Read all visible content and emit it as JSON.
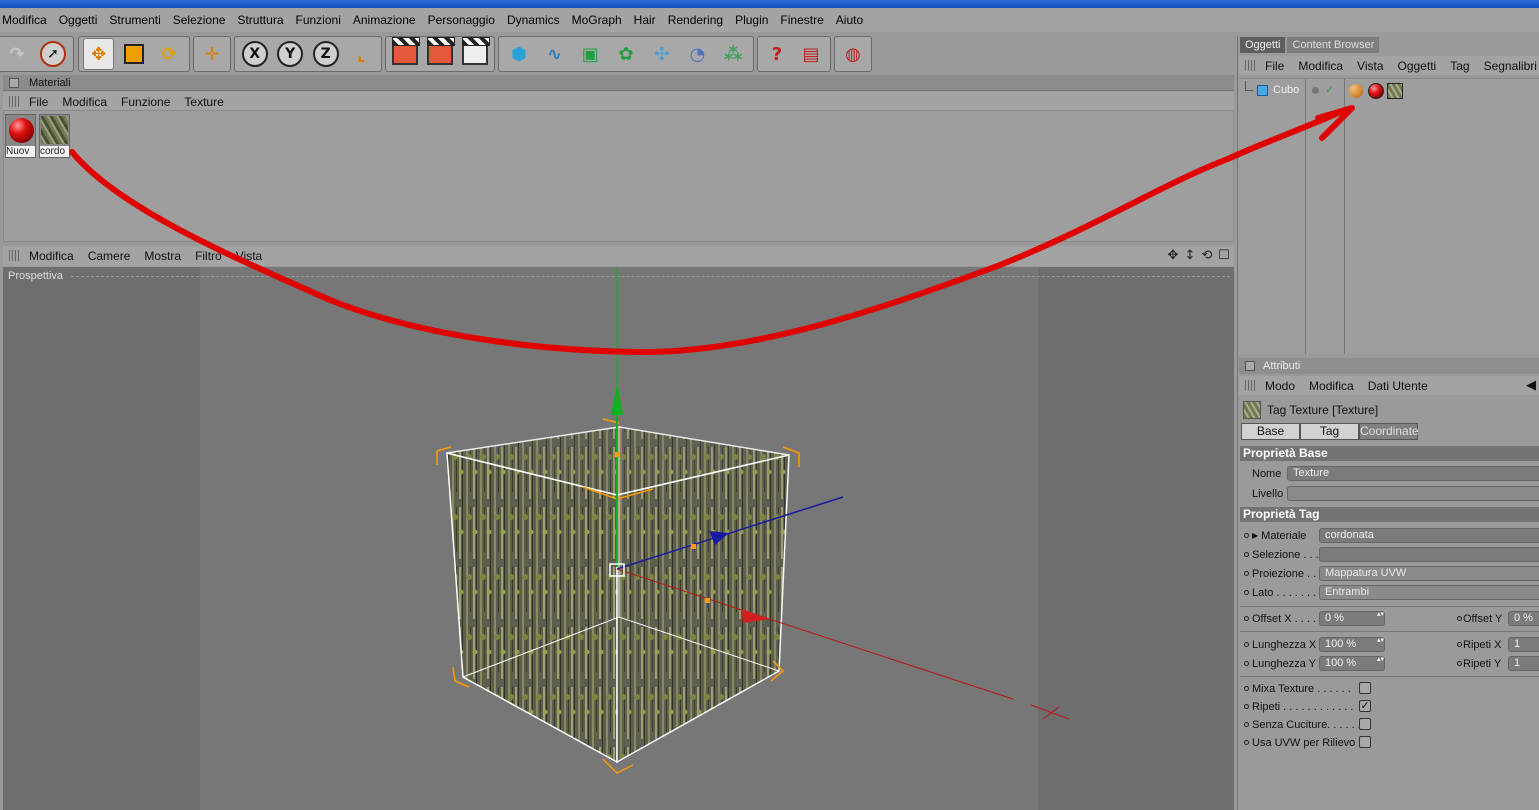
{
  "menubar": [
    "Modifica",
    "Oggetti",
    "Strumenti",
    "Selezione",
    "Struttura",
    "Funzioni",
    "Animazione",
    "Personaggio",
    "Dynamics",
    "MoGraph",
    "Hair",
    "Rendering",
    "Plugin",
    "Finestre",
    "Aiuto"
  ],
  "materials": {
    "title": "Materiali",
    "menu": [
      "File",
      "Modifica",
      "Funzione",
      "Texture"
    ],
    "items": [
      {
        "label": "Nuov"
      },
      {
        "label": "cordo"
      }
    ]
  },
  "viewport": {
    "menu": [
      "Modifica",
      "Camere",
      "Mostra",
      "Filtro",
      "Vista"
    ],
    "label": "Prospettiva"
  },
  "objects": {
    "tabs": [
      "Oggetti",
      "Content Browser"
    ],
    "menu": [
      "File",
      "Modifica",
      "Vista",
      "Oggetti",
      "Tag",
      "Segnalibri"
    ],
    "object_name": "Cubo"
  },
  "attributes": {
    "title": "Attributi",
    "menu": [
      "Modo",
      "Modifica",
      "Dati Utente"
    ],
    "tag_title": "Tag Texture [Texture]",
    "subtabs": [
      "Base",
      "Tag",
      "Coordinate"
    ],
    "section_base": "Proprietà Base",
    "nome_label": "Nome",
    "nome_value": "Texture",
    "livello_label": "Livello",
    "section_tag": "Proprietà Tag",
    "materiale_label": "Materiale",
    "materiale_value": "cordonata",
    "selezione_label": "Selezione . . .",
    "proiezione_label": "Proiezione . .",
    "proiezione_value": "Mappatura UVW",
    "lato_label": "Lato . . . . . . .",
    "lato_value": "Entrambi",
    "offsetx_label": "Offset X . . . .",
    "offsetx_value": "0 %",
    "offsety_label": "Offset Y",
    "offsety_value": "0 %",
    "lungx_label": "Lunghezza X",
    "lungx_value": "100 %",
    "ripetix_label": "Ripeti X",
    "ripetix_value": "1",
    "lungy_label": "Lunghezza Y",
    "lungy_value": "100 %",
    "ripetiy_label": "Ripeti Y",
    "ripetiy_value": "1",
    "mixa_label": "Mixa Texture . . . . . .",
    "mixa_checked": false,
    "ripeti_label": "Ripeti . . . . . . . . . . . .",
    "ripeti_checked": true,
    "senza_label": "Senza Cuciture. . . . . .",
    "senza_checked": false,
    "usauvw_label": "Usa UVW per Rilievo",
    "usauvw_checked": false
  },
  "colors": {
    "accent_red": "#e00000",
    "axis_green": "#10b020",
    "axis_blue": "#1a1aa0",
    "selection_orange": "#ff9a00"
  }
}
